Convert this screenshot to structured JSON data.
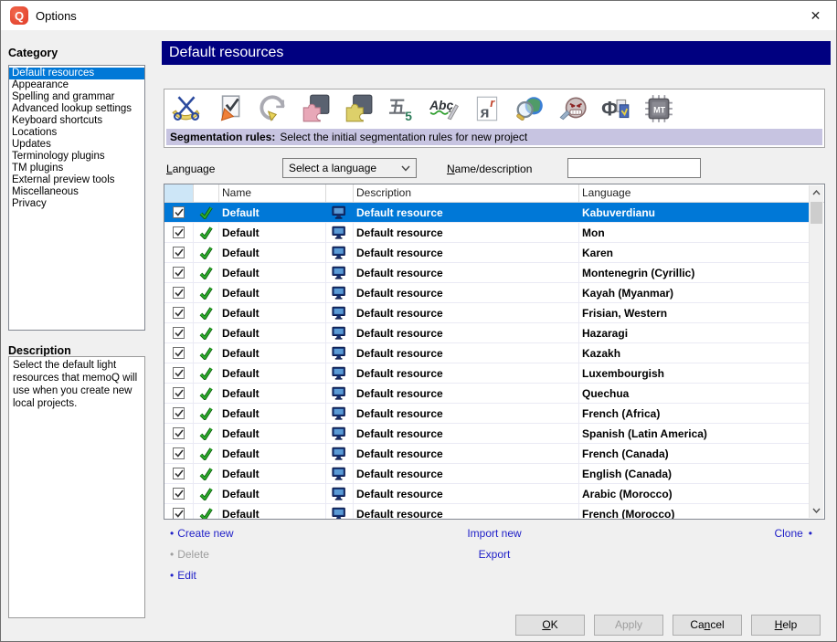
{
  "window": {
    "title": "Options",
    "close_glyph": "✕",
    "logo_letter": "Q"
  },
  "sidebar": {
    "category_label": "Category",
    "items": [
      {
        "label": "Default resources",
        "selected": true
      },
      {
        "label": "Appearance"
      },
      {
        "label": "Spelling and grammar"
      },
      {
        "label": "Advanced lookup settings"
      },
      {
        "label": "Keyboard shortcuts"
      },
      {
        "label": "Locations"
      },
      {
        "label": "Updates"
      },
      {
        "label": "Terminology plugins"
      },
      {
        "label": "TM plugins"
      },
      {
        "label": "External preview tools"
      },
      {
        "label": "Miscellaneous"
      },
      {
        "label": "Privacy"
      }
    ],
    "description_label": "Description",
    "description_text": "Select the default light resources that memoQ will use when you create new local projects."
  },
  "main": {
    "header_title": "Default resources",
    "toolbar": {
      "icons": [
        "segmentation-rules",
        "qa-settings",
        "autocorrect",
        "filter-configurations",
        "export-path-rules",
        "number-formats",
        "ignore-lists",
        "autotranslation-rules",
        "web-search-settings",
        "swearword-lists",
        "non-translatable-lists",
        "machine-translation-settings"
      ],
      "status_bold": "Segmentation rules:",
      "status_text": "Select the initial segmentation rules for new project"
    },
    "filters": {
      "language_label": {
        "text": "Language",
        "u": 0
      },
      "language_value": "Select a language",
      "name_label": {
        "text": "Name/description",
        "u": 0
      },
      "name_value": ""
    },
    "table": {
      "headers": {
        "name": "Name",
        "description": "Description",
        "language": "Language"
      },
      "rows": [
        {
          "checked": true,
          "name": "Default",
          "description": "Default resource",
          "language": "Kabuverdianu",
          "selected": true
        },
        {
          "checked": true,
          "name": "Default",
          "description": "Default resource",
          "language": "Mon"
        },
        {
          "checked": true,
          "name": "Default",
          "description": "Default resource",
          "language": "Karen"
        },
        {
          "checked": true,
          "name": "Default",
          "description": "Default resource",
          "language": "Montenegrin (Cyrillic)"
        },
        {
          "checked": true,
          "name": "Default",
          "description": "Default resource",
          "language": "Kayah (Myanmar)"
        },
        {
          "checked": true,
          "name": "Default",
          "description": "Default resource",
          "language": "Frisian, Western"
        },
        {
          "checked": true,
          "name": "Default",
          "description": "Default resource",
          "language": "Hazaragi"
        },
        {
          "checked": true,
          "name": "Default",
          "description": "Default resource",
          "language": "Kazakh"
        },
        {
          "checked": true,
          "name": "Default",
          "description": "Default resource",
          "language": "Luxembourgish"
        },
        {
          "checked": true,
          "name": "Default",
          "description": "Default resource",
          "language": "Quechua"
        },
        {
          "checked": true,
          "name": "Default",
          "description": "Default resource",
          "language": "French (Africa)"
        },
        {
          "checked": true,
          "name": "Default",
          "description": "Default resource",
          "language": "Spanish (Latin America)"
        },
        {
          "checked": true,
          "name": "Default",
          "description": "Default resource",
          "language": "French (Canada)"
        },
        {
          "checked": true,
          "name": "Default",
          "description": "Default resource",
          "language": "English (Canada)"
        },
        {
          "checked": true,
          "name": "Default",
          "description": "Default resource",
          "language": "Arabic (Morocco)"
        },
        {
          "checked": true,
          "name": "Default",
          "description": "Default resource",
          "language": "French (Morocco)"
        }
      ]
    },
    "links": {
      "bullet": "•",
      "create_new": "Create new",
      "delete": "Delete",
      "edit": "Edit",
      "import_new": "Import new",
      "export": "Export",
      "clone": "Clone"
    },
    "buttons": {
      "ok": {
        "text": "OK",
        "u": 0
      },
      "apply": {
        "text": "Apply",
        "u": -1,
        "disabled": true
      },
      "cancel": {
        "text": "Cancel",
        "u": 2
      },
      "help": {
        "text": "Help",
        "u": 0
      }
    }
  },
  "colors": {
    "selection_blue": "#0078d7",
    "header_navy": "#000080",
    "status_lavender": "#c7c4e1",
    "link_blue": "#2121c8",
    "brand_red": "#e8402f",
    "checkbox_header_blue": "#cde6f7"
  }
}
